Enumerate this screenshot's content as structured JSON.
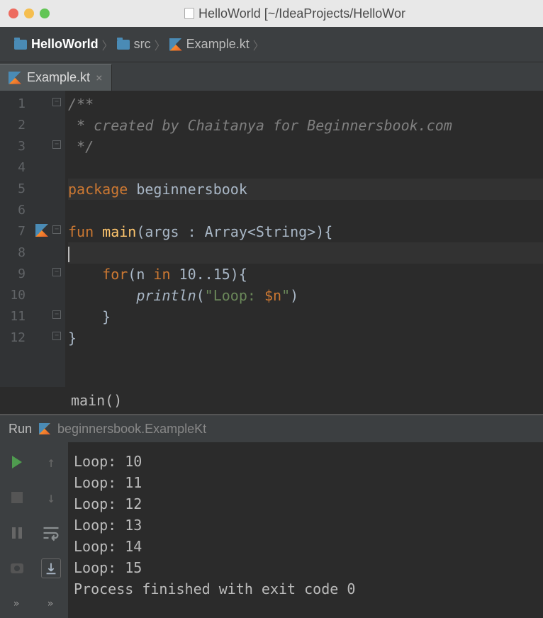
{
  "titlebar": {
    "title": "HelloWorld [~/IdeaProjects/HelloWor",
    "traffic_colors": {
      "close": "#ed6b5f",
      "min": "#f5be4f",
      "max": "#62c555"
    }
  },
  "breadcrumb": [
    {
      "label": "HelloWorld",
      "icon": "folder",
      "active": true
    },
    {
      "label": "src",
      "icon": "folder",
      "active": false
    },
    {
      "label": "Example.kt",
      "icon": "kotlin",
      "active": false
    }
  ],
  "tabs": [
    {
      "label": "Example.kt",
      "icon": "kotlin",
      "closeable": true
    }
  ],
  "editor": {
    "line_numbers": [
      "1",
      "2",
      "3",
      "4",
      "5",
      "6",
      "7",
      "8",
      "9",
      "10",
      "11",
      "12"
    ],
    "lines": {
      "l1_comment": "/**",
      "l2_comment": " * created by Chaitanya for Beginnersbook.com",
      "l3_comment": " */",
      "l4": "",
      "l5_kw": "package",
      "l5_pkg": " beginnersbook",
      "l6": "",
      "l7_kw": "fun ",
      "l7_name": "main",
      "l7_params": "(args : Array<String>){",
      "l8": "",
      "l9_kw": "    for",
      "l9_rest_a": "(n ",
      "l9_kw2": "in",
      "l9_rest_b": " 10..15){",
      "l10_indent": "        ",
      "l10_fn": "println",
      "l10_paren": "(",
      "l10_str_a": "\"Loop: ",
      "l10_var": "$n",
      "l10_str_b": "\"",
      "l10_paren2": ")",
      "l11": "    }",
      "l12": "}"
    },
    "structure_hint": "main()"
  },
  "run": {
    "label": "Run",
    "target": "beginnersbook.ExampleKt",
    "output": [
      "Loop: 10",
      "Loop: 11",
      "Loop: 12",
      "Loop: 13",
      "Loop: 14",
      "Loop: 15",
      "",
      "Process finished with exit code 0"
    ]
  }
}
